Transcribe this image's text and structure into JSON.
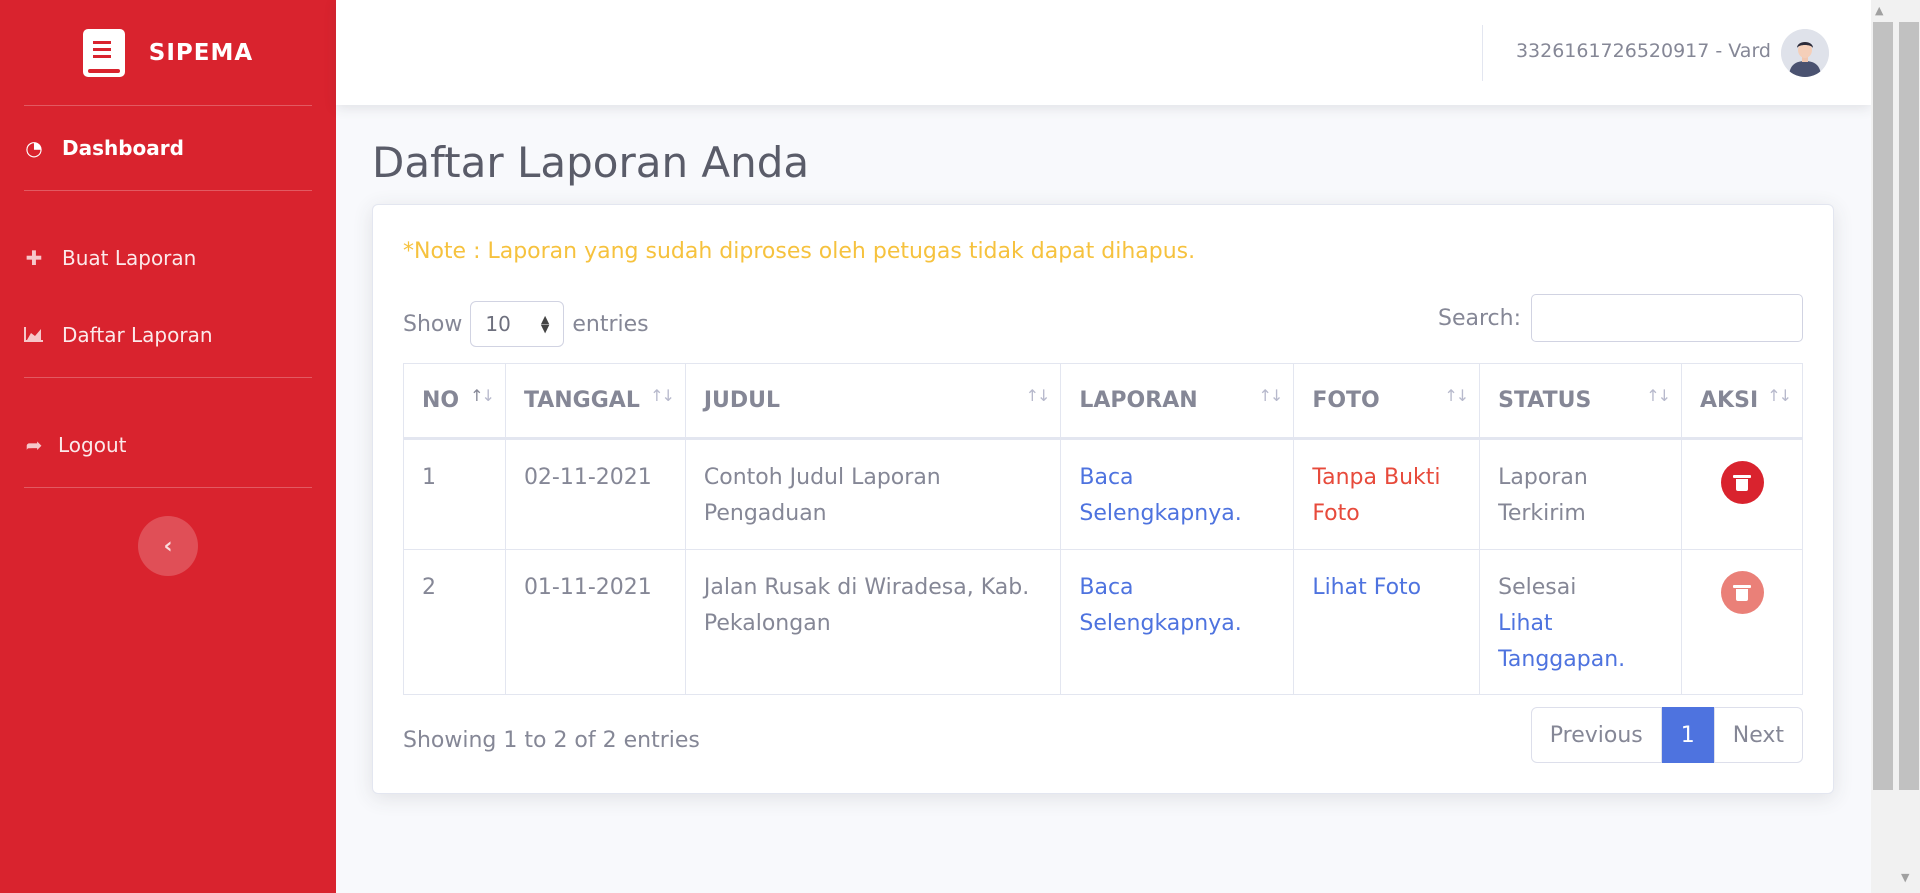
{
  "app": {
    "brand": "SIPEMA"
  },
  "sidebar": {
    "items": [
      {
        "label": "Dashboard",
        "icon": "dashboard-icon"
      },
      {
        "label": "Buat Laporan",
        "icon": "plus-icon"
      },
      {
        "label": "Daftar Laporan",
        "icon": "chart-area-icon"
      },
      {
        "label": "Logout",
        "icon": "sign-out-icon"
      }
    ],
    "toggle": "‹"
  },
  "topbar": {
    "user": "3326161726520917 - Vard"
  },
  "main": {
    "title": "Daftar Laporan Anda",
    "note": "*Note : Laporan yang sudah diproses oleh petugas tidak dapat dihapus.",
    "show_label": "Show",
    "entries_label": "entries",
    "entries_value": "10",
    "search_label": "Search:",
    "search_value": "",
    "columns": [
      "NO",
      "TANGGAL",
      "JUDUL",
      "LAPORAN",
      "FOTO",
      "STATUS",
      "AKSI"
    ],
    "rows": [
      {
        "no": "1",
        "tanggal": "02-11-2021",
        "judul": "Contoh Judul Laporan Pengaduan",
        "laporan": "Baca Selengkapnya.",
        "foto": "Tanpa Bukti Foto",
        "status": "Laporan Terkirim",
        "status_link": ""
      },
      {
        "no": "2",
        "tanggal": "01-11-2021",
        "judul": "Jalan Rusak di Wiradesa, Kab. Pekalongan",
        "laporan": "Baca Selengkapnya.",
        "foto": "Lihat Foto",
        "status": "Selesai",
        "status_link": "Lihat Tanggapan."
      }
    ],
    "info": "Showing 1 to 2 of 2 entries",
    "pagination": {
      "prev": "Previous",
      "current": "1",
      "next": "Next"
    }
  },
  "colors": {
    "sidebar": "#d9232e",
    "primary": "#4e73df",
    "warning": "#f6c23e",
    "danger": "#e74a3b"
  }
}
